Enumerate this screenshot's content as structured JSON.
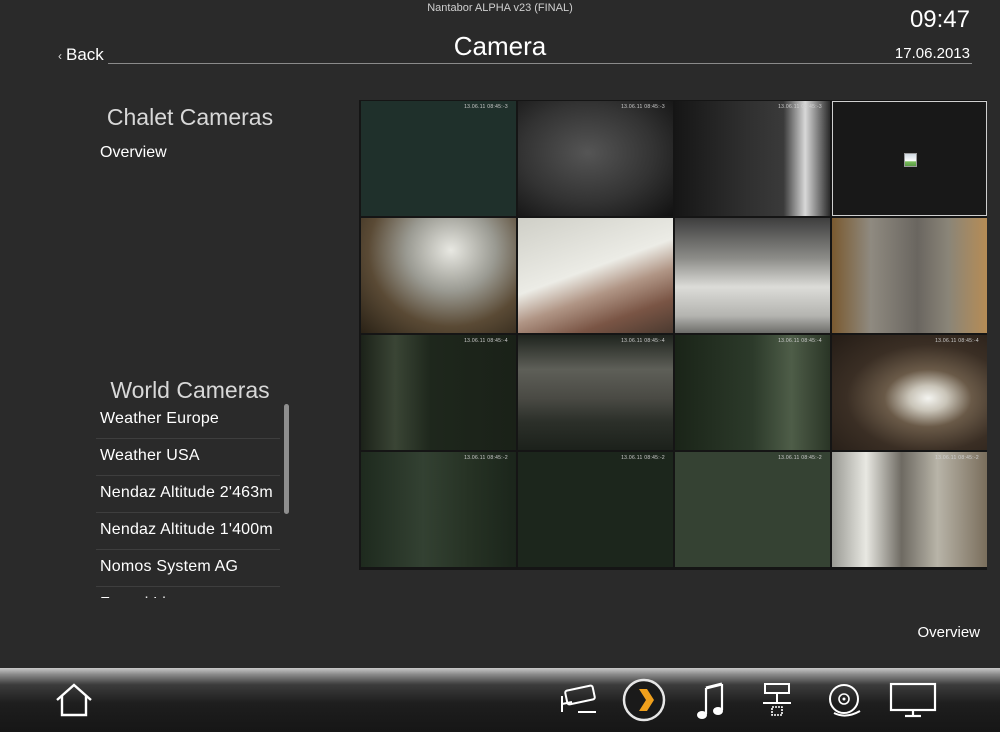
{
  "app": {
    "title": "Nantabor ALPHA v23 (FINAL)"
  },
  "header": {
    "time": "09:47",
    "date": "17.06.2013",
    "back_label": "Back",
    "title": "Camera"
  },
  "sidebar": {
    "chalet_title": "Chalet Cameras",
    "overview_label": "Overview",
    "world_title": "World Cameras",
    "world_items": [
      {
        "label": "Weather Europe"
      },
      {
        "label": "Weather USA"
      },
      {
        "label": "Nendaz Altitude 2'463m"
      },
      {
        "label": "Nendaz Altitude 1'400m"
      },
      {
        "label": "Nomos System AG"
      },
      {
        "label": "Ferrari Live"
      }
    ]
  },
  "camera_grid": {
    "feeds": [
      {
        "timestamp": "13.06.11 08:45:-3",
        "scene": "dark-teal"
      },
      {
        "timestamp": "13.06.11 08:45:-3",
        "scene": "hallway-fisheye"
      },
      {
        "timestamp": "13.06.11 08:45:-3",
        "scene": "corridor-light"
      },
      {
        "timestamp": "",
        "scene": "broken-image"
      },
      {
        "timestamp": "",
        "scene": "room-chair"
      },
      {
        "timestamp": "",
        "scene": "bathroom-bright"
      },
      {
        "timestamp": "",
        "scene": "kitchen"
      },
      {
        "timestamp": "",
        "scene": "room-wood"
      },
      {
        "timestamp": "13.06.11 08:45:-4",
        "scene": "dark-door"
      },
      {
        "timestamp": "13.06.11 08:45:-4",
        "scene": "window-blinds"
      },
      {
        "timestamp": "13.06.11 08:45:-4",
        "scene": "dark-corner"
      },
      {
        "timestamp": "13.06.11 08:45:-4",
        "scene": "glare"
      },
      {
        "timestamp": "13.06.11 08:45:-2",
        "scene": "dark-hall"
      },
      {
        "timestamp": "13.06.11 08:45:-2",
        "scene": "very-dark"
      },
      {
        "timestamp": "13.06.11 08:45:-2",
        "scene": "dark-green"
      },
      {
        "timestamp": "13.06.11 08:45:-2",
        "scene": "bright-room"
      }
    ]
  },
  "footer": {
    "overview_label": "Overview"
  },
  "bottom_bar": {
    "icons": [
      {
        "name": "home-icon"
      },
      {
        "name": "security-camera-icon"
      },
      {
        "name": "plex-icon"
      },
      {
        "name": "music-note-icon"
      },
      {
        "name": "network-device-icon"
      },
      {
        "name": "media-disc-icon"
      },
      {
        "name": "tv-monitor-icon"
      }
    ],
    "accent_color": "#f0a01c"
  }
}
